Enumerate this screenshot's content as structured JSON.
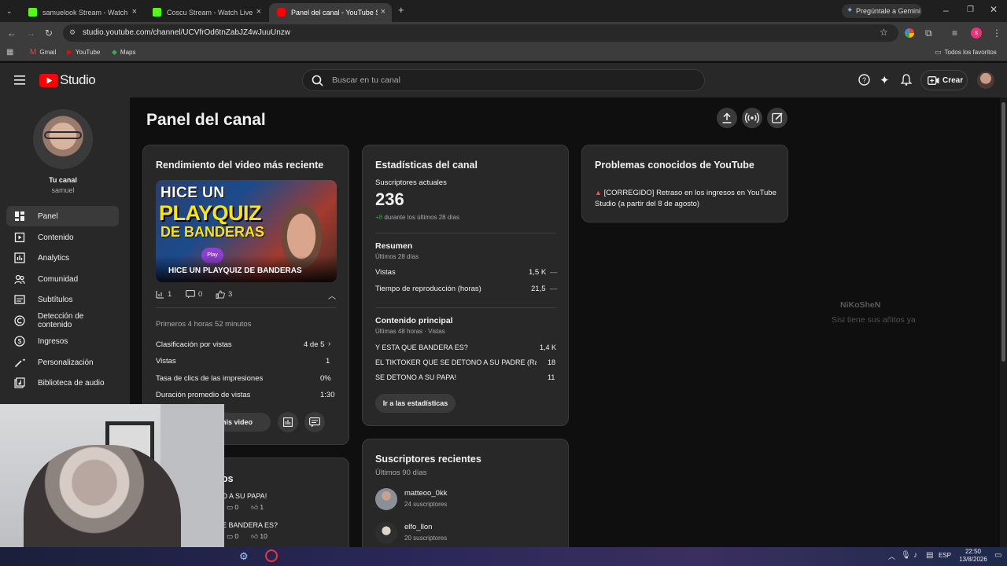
{
  "browser": {
    "tabs": [
      {
        "title": "samuelook Stream - Watch Live on Kick",
        "fav_color": "#53fc18"
      },
      {
        "title": "Coscu Stream - Watch Live on Kick",
        "fav_color": "#53fc18"
      },
      {
        "title": "Panel del canal - YouTube Studio",
        "fav_color": "#ff0000"
      }
    ],
    "new_tab": "+",
    "gemini": "Pregúntale a Gemini",
    "url": "studio.youtube.com/channel/UCVfrOd6tnZabJZ4wJuuUnzw",
    "bookmarks": [
      "Gmail",
      "YouTube",
      "Maps"
    ],
    "all_bookmarks": "Todos los favoritos",
    "profile_initial": "s"
  },
  "header": {
    "logo": "Studio",
    "search_placeholder": "Buscar en tu canal",
    "create": "Crear"
  },
  "sidebar": {
    "channel_label": "Tu canal",
    "channel_name": "samuel",
    "items": [
      "Panel",
      "Contenido",
      "Analytics",
      "Comunidad",
      "Subtítulos",
      "Detección de contenido",
      "Ingresos",
      "Personalización",
      "Biblioteca de audio"
    ]
  },
  "page": {
    "title": "Panel del canal"
  },
  "latest": {
    "title": "Rendimiento del video más reciente",
    "thumb_line1": "HICE UN",
    "thumb_line2": "PLAYQUIZ",
    "thumb_line3": "DE BANDERAS",
    "thumb_badge": "Play",
    "video_title": "HICE UN PLAYQUIZ DE BANDERAS",
    "views": "1",
    "comments": "0",
    "likes": "3",
    "period": "Primeros 4 horas 52 minutos",
    "rows": [
      {
        "label": "Clasificación por vistas",
        "value": "4 de 5"
      },
      {
        "label": "Vistas",
        "value": "1"
      },
      {
        "label": "Tasa de clics de las impresiones",
        "value": "0%"
      },
      {
        "label": "Duración promedio de vistas",
        "value": "1:30"
      }
    ],
    "button": "n this video"
  },
  "partial_card": {
    "title": "os",
    "rows": [
      {
        "text": "O A SU PAPA!",
        "comments": "0",
        "likes": "1"
      },
      {
        "text": "E BANDERA ES?",
        "comments": "0",
        "likes": "10"
      }
    ]
  },
  "stats": {
    "title": "Estadísticas del canal",
    "subs_label": "Suscriptores actuales",
    "subs_value": "236",
    "subs_delta": "+8",
    "subs_delta_text": "durante los últimos 28 días",
    "summary_title": "Resumen",
    "summary_sub": "Últimos 28 días",
    "summary_rows": [
      {
        "label": "Vistas",
        "value": "1,5 K",
        "trend": "—"
      },
      {
        "label": "Tiempo de reproducción (horas)",
        "value": "21,5",
        "trend": "—"
      }
    ],
    "top_title": "Contenido principal",
    "top_sub": "Últimas 48 horas · Vistas",
    "top_rows": [
      {
        "label": "Y ESTA QUE BANDERA ES?",
        "value": "1,4 K"
      },
      {
        "label": "EL TIKTOKER QUE SE DETONO A SU PADRE (Ra...",
        "value": "18"
      },
      {
        "label": "SE DETONO A SU PAPA!",
        "value": "11"
      }
    ],
    "button": "Ir a las estadísticas"
  },
  "issues": {
    "title": "Problemas conocidos de YouTube",
    "item": "[CORREGIDO] Retraso en los ingresos en YouTube Studio (a partir del 8 de agosto)"
  },
  "recent_subs": {
    "title": "Suscriptores recientes",
    "sub": "Últimos 90 días",
    "items": [
      {
        "name": "matteoo_0kk",
        "subs": "24 suscriptores"
      },
      {
        "name": "elfo_llon",
        "subs": "20 suscriptores"
      }
    ]
  },
  "chat_overlay": {
    "name": "NiKoSheN",
    "message": "Sisi tiene sus añitos ya"
  },
  "taskbar": {
    "lang": "ESP",
    "time": "22:50",
    "date": "13/8/2026"
  }
}
